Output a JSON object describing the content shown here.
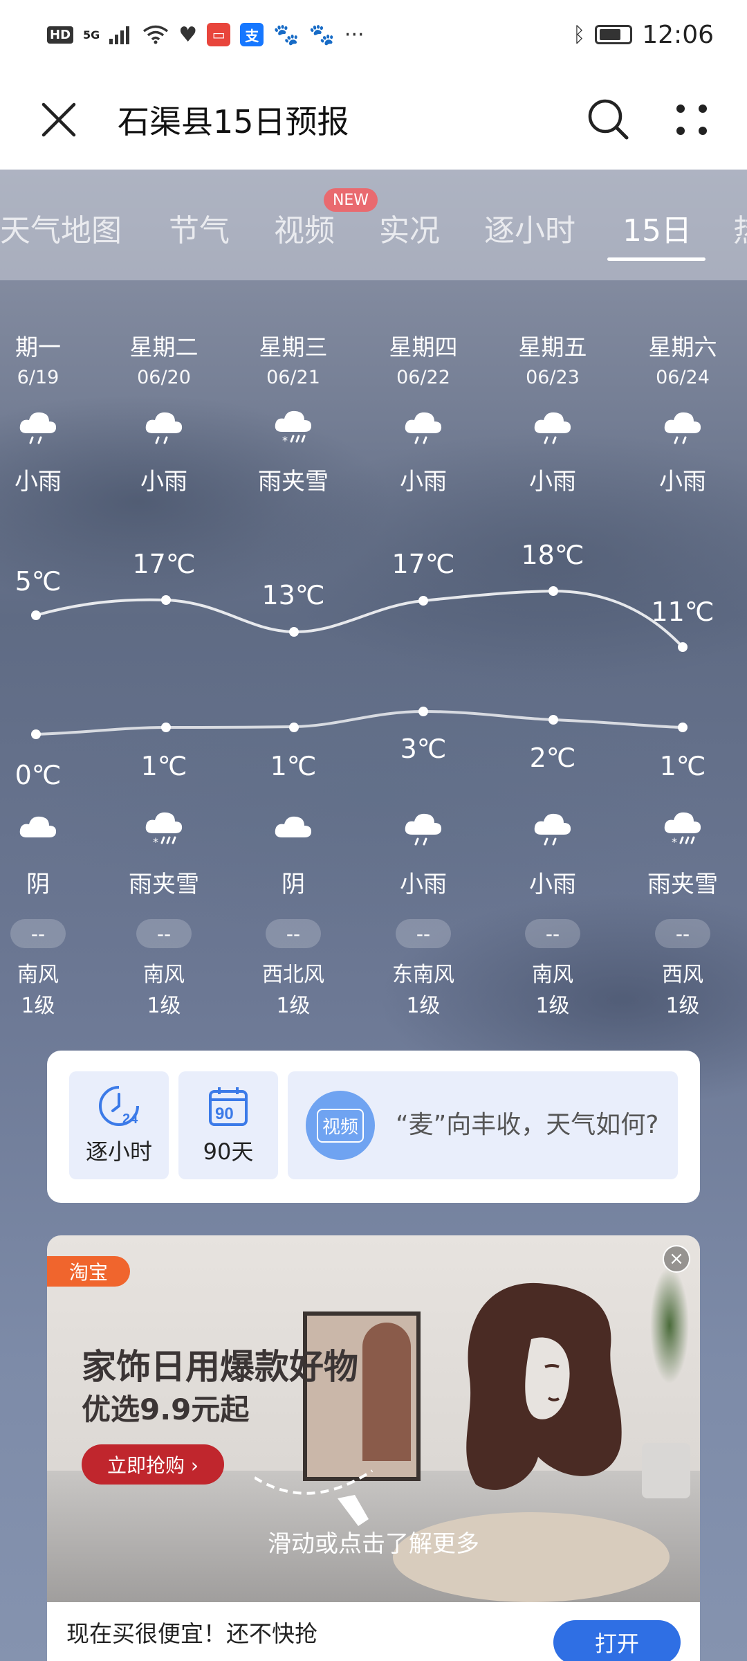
{
  "status_bar": {
    "left_icons": [
      "HD",
      "5G",
      "signal-icon",
      "wifi-icon",
      "heart-icon",
      "app-icon",
      "alipay-icon",
      "paw-icon",
      "paw-icon"
    ],
    "more": "···",
    "time": "12:06"
  },
  "app_bar": {
    "title": "石渠县15日预报"
  },
  "tabs": [
    {
      "label": "天气地图"
    },
    {
      "label": "节气"
    },
    {
      "label": "视频",
      "badge": "NEW"
    },
    {
      "label": "实况"
    },
    {
      "label": "逐小时"
    },
    {
      "label": "15日",
      "active": true
    },
    {
      "label": "热"
    }
  ],
  "forecast": [
    {
      "weekday": "期一",
      "date": "6/19",
      "day_weather": "小雨",
      "high": "5℃",
      "low": "0℃",
      "night_weather": "阴",
      "aqi": "--",
      "wind_dir": "南风",
      "wind_level": "1级"
    },
    {
      "weekday": "星期二",
      "date": "06/20",
      "day_weather": "小雨",
      "high": "17℃",
      "low": "1℃",
      "night_weather": "雨夹雪",
      "aqi": "--",
      "wind_dir": "南风",
      "wind_level": "1级"
    },
    {
      "weekday": "星期三",
      "date": "06/21",
      "day_weather": "雨夹雪",
      "high": "13℃",
      "low": "1℃",
      "night_weather": "阴",
      "aqi": "--",
      "wind_dir": "西北风",
      "wind_level": "1级"
    },
    {
      "weekday": "星期四",
      "date": "06/22",
      "day_weather": "小雨",
      "high": "17℃",
      "low": "3℃",
      "night_weather": "小雨",
      "aqi": "--",
      "wind_dir": "东南风",
      "wind_level": "1级"
    },
    {
      "weekday": "星期五",
      "date": "06/23",
      "day_weather": "小雨",
      "high": "18℃",
      "low": "2℃",
      "night_weather": "小雨",
      "aqi": "--",
      "wind_dir": "南风",
      "wind_level": "1级"
    },
    {
      "weekday": "星期六",
      "date": "06/24",
      "day_weather": "小雨",
      "high": "11℃",
      "low": "1℃",
      "night_weather": "雨夹雪",
      "aqi": "--",
      "wind_dir": "西风",
      "wind_level": "1级"
    }
  ],
  "quick_links": {
    "hourly_label": "逐小时",
    "hourly_icon_num": "24",
    "days90_label": "90天",
    "days90_icon_num": "90",
    "video_badge": "视频",
    "video_text": "“麦”向丰收，天气如何?"
  },
  "ad": {
    "tag": "淘宝",
    "close": "×",
    "headline": "家饰日用爆款好物",
    "subline": "优选9.9元起",
    "cta": "立即抢购 ›",
    "hint": "滑动或点击了解更多",
    "bottom_text": "现在买很便宜！还不快抢",
    "open_button": "打开"
  }
}
